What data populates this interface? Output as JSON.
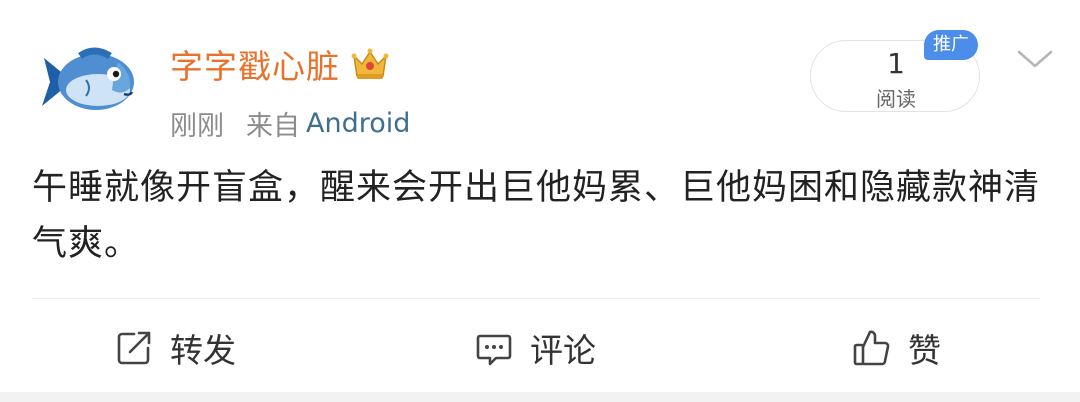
{
  "post": {
    "username": "字字戳心脏",
    "time": "刚刚",
    "source_prefix": "来自",
    "source": "Android",
    "read_count": "1",
    "read_label": "阅读",
    "promo_badge": "推广",
    "content": "午睡就像开盲盒，醒来会开出巨他妈累、巨他妈困和隐藏款神清气爽。"
  },
  "actions": {
    "repost_label": "转发",
    "comment_label": "评论",
    "like_label": "赞"
  },
  "icons": {
    "avatar": "fish-avatar",
    "vip": "crown-icon",
    "more": "chevron-down-icon",
    "repost": "repost-icon",
    "comment": "comment-icon",
    "like": "thumbs-up-icon"
  },
  "colors": {
    "username": "#e8722c",
    "promo_badge_bg": "#4b8de8",
    "source_link": "#3f6f8f"
  }
}
